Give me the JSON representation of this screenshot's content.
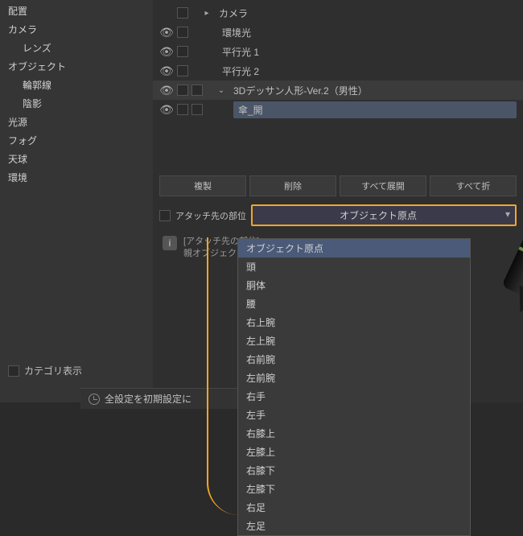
{
  "sidebar": {
    "items": [
      {
        "label": "配置",
        "indent": false
      },
      {
        "label": "カメラ",
        "indent": false
      },
      {
        "label": "レンズ",
        "indent": true
      },
      {
        "label": "オブジェクト",
        "indent": false
      },
      {
        "label": "輪郭線",
        "indent": true
      },
      {
        "label": "陰影",
        "indent": true
      },
      {
        "label": "光源",
        "indent": false
      },
      {
        "label": "フォグ",
        "indent": false
      },
      {
        "label": "天球",
        "indent": false
      },
      {
        "label": "環境",
        "indent": false
      }
    ]
  },
  "layers": [
    {
      "vis": "",
      "label": "カメラ",
      "arrow": "▸",
      "indent": 0,
      "hl": false
    },
    {
      "vis": "👁",
      "label": "環境光",
      "arrow": "",
      "indent": 1,
      "hl": false
    },
    {
      "vis": "👁",
      "label": "平行光 1",
      "arrow": "",
      "indent": 1,
      "hl": false
    },
    {
      "vis": "👁",
      "label": "平行光 2",
      "arrow": "",
      "indent": 1,
      "hl": false
    },
    {
      "vis": "👁",
      "label": "3Dデッサン人形-Ver.2（男性）",
      "arrow": "⌄",
      "indent": 0,
      "hl": false,
      "sel": true
    },
    {
      "vis": "👁",
      "label": "傘_開",
      "arrow": "",
      "indent": 2,
      "hl": true
    }
  ],
  "buttons": {
    "duplicate": "複製",
    "delete": "削除",
    "expand_all": "すべて展開",
    "collapse_all": "すべて折"
  },
  "attach": {
    "label": "アタッチ先の部位",
    "selected": "オブジェクト原点"
  },
  "info": {
    "title": "[アタッチ先の部位]",
    "body": "親オブジェクトがデッサンて移動したり回転したり"
  },
  "dropdown_options": [
    "オブジェクト原点",
    "頭",
    "胴体",
    "腰",
    "右上腕",
    "左上腕",
    "右前腕",
    "左前腕",
    "右手",
    "左手",
    "右膝上",
    "左膝上",
    "右膝下",
    "左膝下",
    "右足",
    "左足"
  ],
  "bottom": {
    "category_show": "カテゴリ表示",
    "reset": "全設定を初期設定に"
  }
}
